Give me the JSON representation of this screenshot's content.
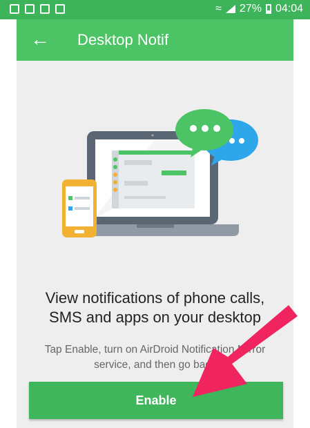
{
  "status_bar": {
    "battery": "27%",
    "time": "04:04"
  },
  "header": {
    "title": "Desktop Notif"
  },
  "main": {
    "headline_line1": "View notifications of phone calls,",
    "headline_line2": "SMS and apps on your desktop",
    "desc_line1": "Tap Enable, turn on AirDroid Notification Mirror",
    "desc_line2": "service, and then go back",
    "enable_label": "Enable"
  },
  "colors": {
    "brand": "#4cc466",
    "button": "#3fb65b",
    "arrow": "#f0245e",
    "status_bar": "#3db35a"
  },
  "icons": {
    "back": "arrow-left-icon",
    "chat_green": "chat-bubble-icon",
    "chat_blue": "chat-bubble-icon"
  }
}
